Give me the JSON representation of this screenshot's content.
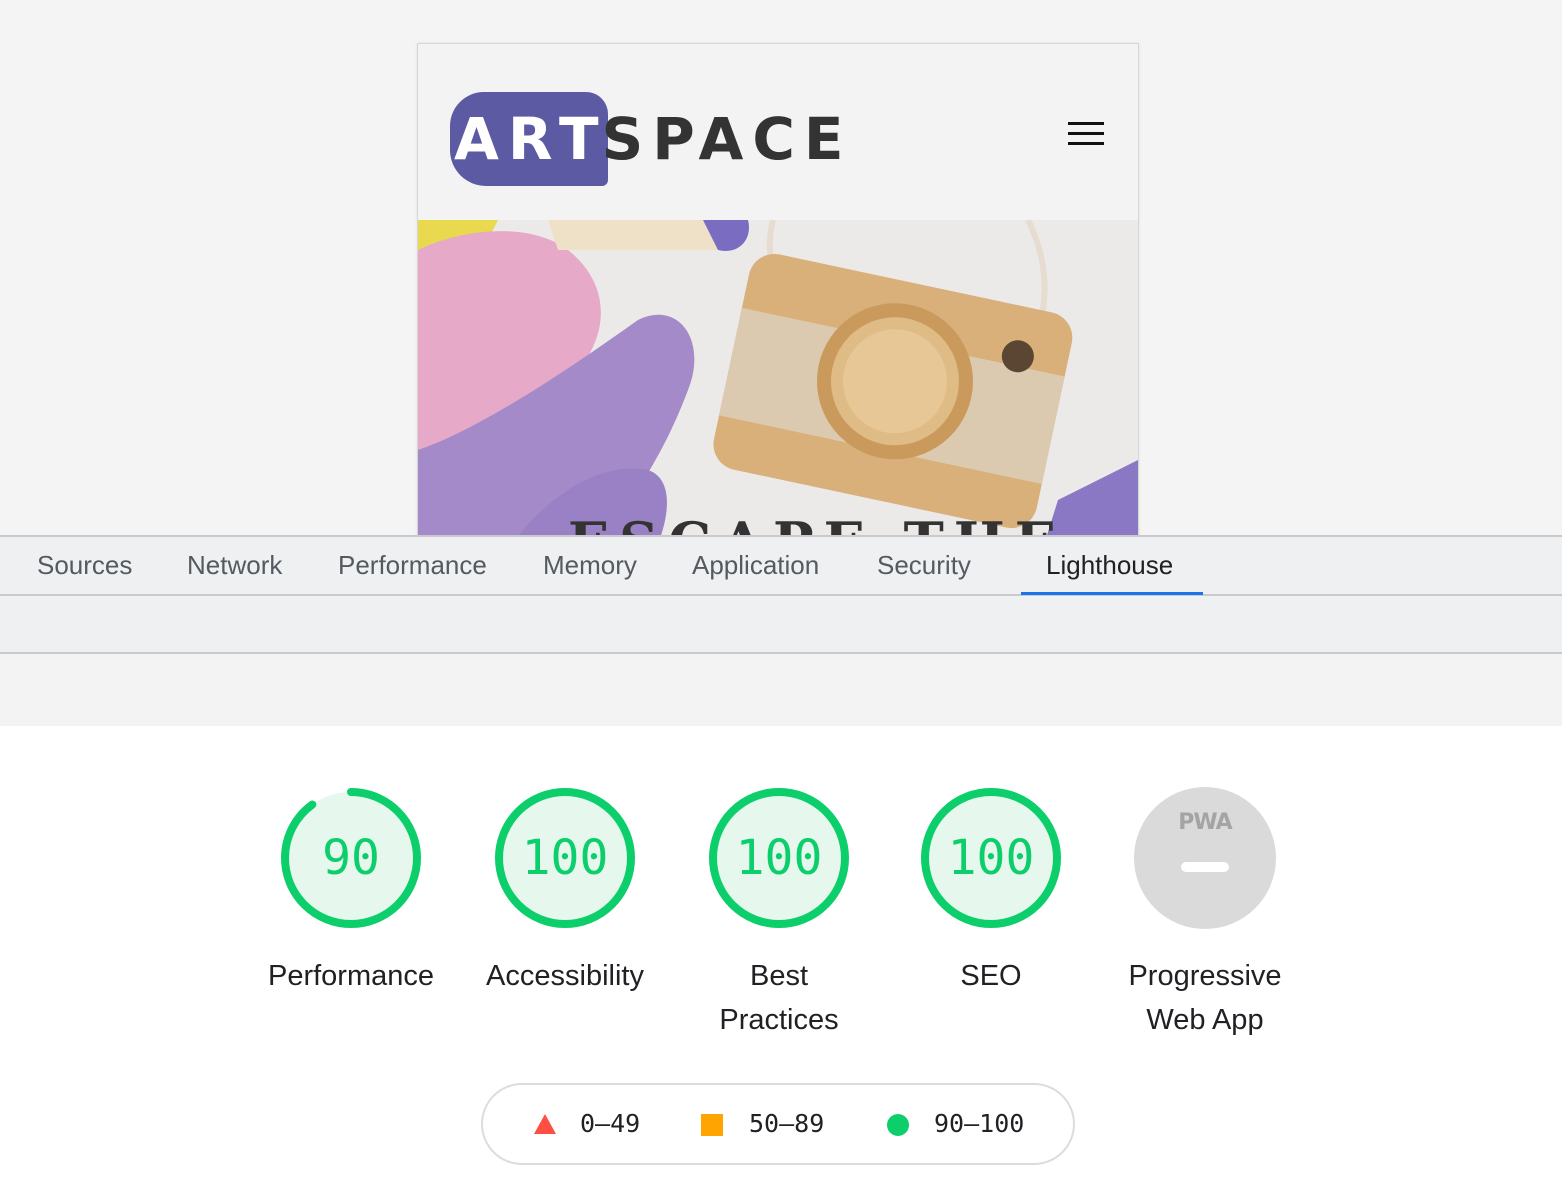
{
  "site": {
    "logo_art": "ART",
    "logo_space": "SPACE",
    "hero_heading": "ESCAPE THE"
  },
  "devtools": {
    "tabs": [
      {
        "label": "Sources",
        "active": false
      },
      {
        "label": "Network",
        "active": false
      },
      {
        "label": "Performance",
        "active": false
      },
      {
        "label": "Memory",
        "active": false
      },
      {
        "label": "Application",
        "active": false
      },
      {
        "label": "Security",
        "active": false
      },
      {
        "label": "Lighthouse",
        "active": true
      }
    ],
    "active_tab_color": "#1a73e8"
  },
  "lighthouse": {
    "scores": [
      {
        "score": "90",
        "label": "Performance",
        "value": 90,
        "status": "pass"
      },
      {
        "score": "100",
        "label": "Accessibility",
        "value": 100,
        "status": "pass"
      },
      {
        "score": "100",
        "label_line1": "Best",
        "label_line2": "Practices",
        "value": 100,
        "status": "pass"
      },
      {
        "score": "100",
        "label": "SEO",
        "value": 100,
        "status": "pass"
      },
      {
        "badge": "PWA",
        "label_line1": "Progressive",
        "label_line2": "Web App",
        "status": "not-applicable"
      }
    ],
    "legend": [
      {
        "range": "0–49",
        "icon": "triangle-icon",
        "color": "#ff4e42"
      },
      {
        "range": "50–89",
        "icon": "square-icon",
        "color": "#ffa400"
      },
      {
        "range": "90–100",
        "icon": "circle-icon",
        "color": "#0cce6b"
      }
    ],
    "pass_color": "#0cce6b",
    "pass_fill": "#e6f7ee"
  }
}
